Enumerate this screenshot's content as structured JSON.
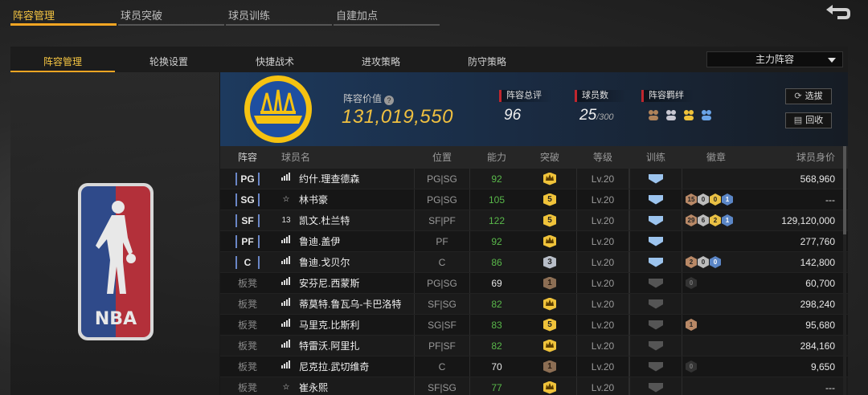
{
  "top_tabs": [
    "阵容管理",
    "球员突破",
    "球员训练",
    "自建加点"
  ],
  "sub_tabs": [
    "阵容管理",
    "轮换设置",
    "快捷战术",
    "进攻策略",
    "防守策略"
  ],
  "lineup_select": "主力阵容",
  "nba_logo_text": "NBA",
  "info": {
    "value_label": "阵容价值",
    "help_icon": "?",
    "value": "131,019,550",
    "rating_label": "阵容总评",
    "rating": "96",
    "count_label": "球员数",
    "count": "25",
    "count_max": "/300",
    "chem_label": "阵容羁绊",
    "btn_select": "选拔",
    "btn_recycle": "回收"
  },
  "columns": {
    "pos": "阵容",
    "name": "球员名",
    "slot": "位置",
    "ovr": "能力",
    "brk": "突破",
    "lvl": "等级",
    "train": "训练",
    "badge": "徽章",
    "price": "球员身价"
  },
  "colors": {
    "accent": "#f5a623",
    "value": "#f0c040",
    "green": "#59b84a",
    "stat_bar": "#c0262e"
  },
  "rows": [
    {
      "pos": "PG",
      "icon": "bars",
      "name": "约什.理查德森",
      "slot": "PG|SG",
      "ovr": "92",
      "ovr_color": "green",
      "brk": "crown",
      "brk_type": "gold",
      "lvl": "Lv.20",
      "train": "blue",
      "badges": [],
      "price": "568,960"
    },
    {
      "pos": "SG",
      "icon": "star",
      "name": "林书豪",
      "slot": "PG|SG",
      "ovr": "105",
      "ovr_color": "green",
      "brk": "5",
      "brk_type": "gold",
      "lvl": "Lv.20",
      "train": "blue",
      "badges": [
        [
          "15",
          "bronze"
        ],
        [
          "0",
          "silver"
        ],
        [
          "0",
          "gold"
        ],
        [
          "1",
          "blue"
        ]
      ],
      "price": "---"
    },
    {
      "pos": "SF",
      "icon": "13",
      "name": "凯文.杜兰特",
      "slot": "SF|PF",
      "ovr": "122",
      "ovr_color": "green",
      "brk": "5",
      "brk_type": "gold",
      "lvl": "Lv.20",
      "train": "blue",
      "badges": [
        [
          "29",
          "bronze"
        ],
        [
          "6",
          "silver"
        ],
        [
          "2",
          "gold"
        ],
        [
          "1",
          "blue"
        ]
      ],
      "price": "129,120,000"
    },
    {
      "pos": "PF",
      "icon": "bars",
      "name": "鲁迪.盖伊",
      "slot": "PF",
      "ovr": "92",
      "ovr_color": "green",
      "brk": "crown",
      "brk_type": "gold",
      "lvl": "Lv.20",
      "train": "blue",
      "badges": [],
      "price": "277,760"
    },
    {
      "pos": "C",
      "icon": "bars",
      "name": "鲁迪.戈贝尔",
      "slot": "C",
      "ovr": "86",
      "ovr_color": "green",
      "brk": "3",
      "brk_type": "silver",
      "lvl": "Lv.20",
      "train": "blue",
      "badges": [
        [
          "2",
          "bronze"
        ],
        [
          "0",
          "silver"
        ],
        [
          "0",
          "blue"
        ]
      ],
      "price": "142,800"
    },
    {
      "pos": "板凳",
      "icon": "bars",
      "name": "安芬尼.西蒙斯",
      "slot": "PG|SG",
      "ovr": "69",
      "ovr_color": "white",
      "brk": "1",
      "brk_type": "bronze",
      "lvl": "Lv.20",
      "train": "grey",
      "badges": [
        [
          "0",
          "dark"
        ]
      ],
      "price": "60,700"
    },
    {
      "pos": "板凳",
      "icon": "bars",
      "name": "蒂莫特.鲁瓦乌-卡巴洛特",
      "slot": "SF|SG",
      "ovr": "82",
      "ovr_color": "green",
      "brk": "crown",
      "brk_type": "gold",
      "lvl": "Lv.20",
      "train": "grey",
      "badges": [],
      "price": "298,240"
    },
    {
      "pos": "板凳",
      "icon": "bars",
      "name": "马里克.比斯利",
      "slot": "SG|SF",
      "ovr": "83",
      "ovr_color": "green",
      "brk": "5",
      "brk_type": "gold",
      "lvl": "Lv.20",
      "train": "grey",
      "badges": [
        [
          "1",
          "bronze"
        ]
      ],
      "price": "95,680"
    },
    {
      "pos": "板凳",
      "icon": "bars",
      "name": "特雷沃.阿里扎",
      "slot": "PF|SF",
      "ovr": "82",
      "ovr_color": "green",
      "brk": "crown",
      "brk_type": "gold",
      "lvl": "Lv.20",
      "train": "grey",
      "badges": [],
      "price": "284,160"
    },
    {
      "pos": "板凳",
      "icon": "bars",
      "name": "尼克拉.武切维奇",
      "slot": "C",
      "ovr": "70",
      "ovr_color": "white",
      "brk": "1",
      "brk_type": "bronze",
      "lvl": "Lv.20",
      "train": "grey",
      "badges": [
        [
          "0",
          "dark"
        ]
      ],
      "price": "9,650"
    },
    {
      "pos": "板凳",
      "icon": "star",
      "name": "崔永熙",
      "slot": "SF|SG",
      "ovr": "77",
      "ovr_color": "green",
      "brk": "crown",
      "brk_type": "gold",
      "lvl": "Lv.20",
      "train": "grey",
      "badges": [],
      "price": "---"
    }
  ]
}
